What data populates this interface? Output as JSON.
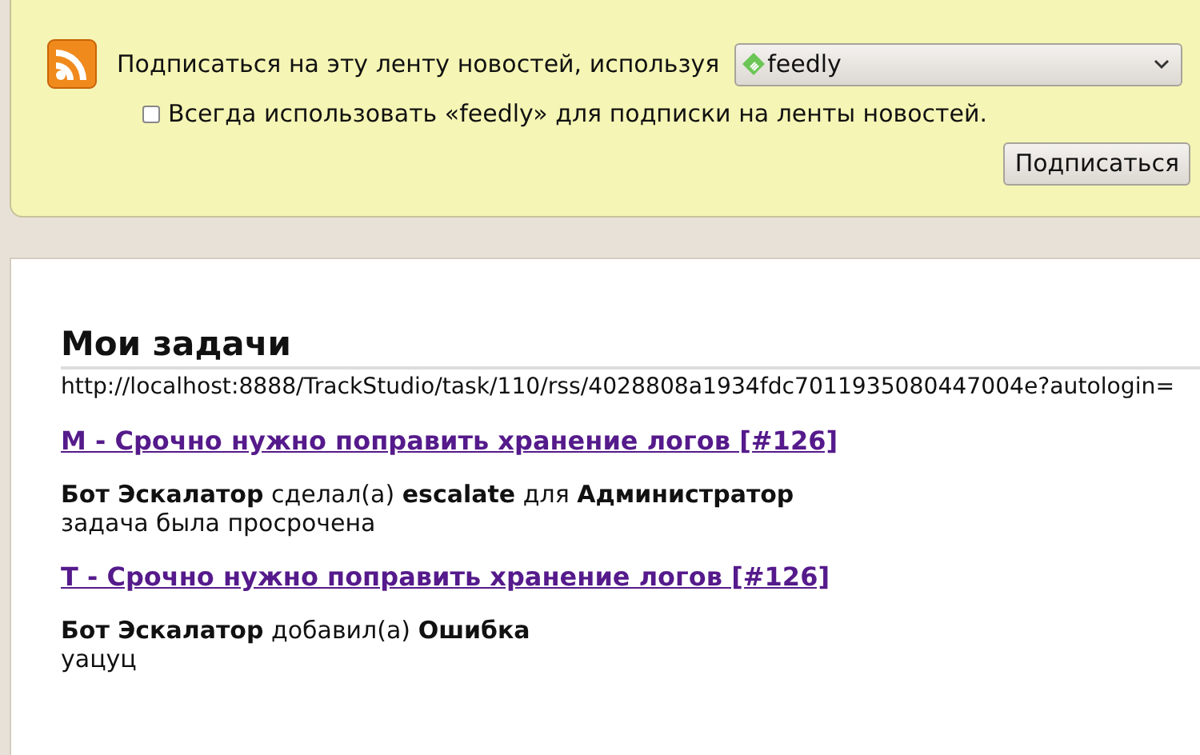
{
  "subscribe_bar": {
    "prompt": "Подписаться на эту ленту новостей, используя",
    "reader_select": {
      "value": "feedly"
    },
    "always_use": {
      "label": "Всегда использовать «feedly» для подписки на ленты новостей.",
      "checked": false
    },
    "subscribe_button": "Подписаться"
  },
  "feed": {
    "title": "Мои задачи",
    "url": "http://localhost:8888/TrackStudio/task/110/rss/4028808a1934fdc7011935080447004e?autologin=",
    "entries": [
      {
        "title": "М - Срочно нужно поправить хранение логов [#126]",
        "summary": "**Бот Эскалатор** сделал(а) **escalate** для **Администратор**",
        "detail": "задача была просрочена"
      },
      {
        "title": "Т - Срочно нужно поправить хранение логов [#126]",
        "summary": "**Бот Эскалатор** добавил(а) **Ошибка**",
        "detail": "уацуц"
      }
    ]
  }
}
